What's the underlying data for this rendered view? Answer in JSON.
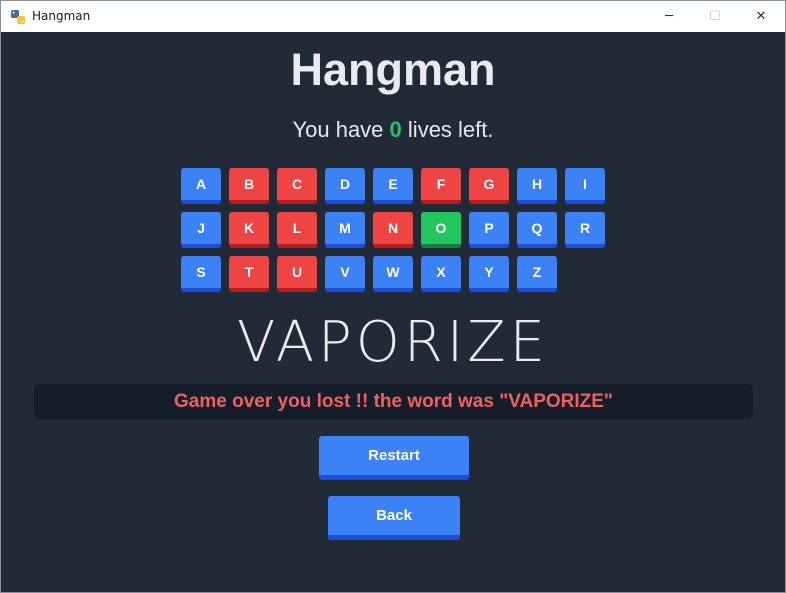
{
  "window": {
    "title": "Hangman",
    "minimize_glyph": "─",
    "maximize_glyph": "☐",
    "close_glyph": "✕"
  },
  "game": {
    "title": "Hangman",
    "lives_prefix": "You have",
    "lives_count": "0",
    "lives_suffix": "lives left.",
    "word": "VAPORIZE",
    "message": "Game over you lost !! the word was \"VAPORIZE\""
  },
  "keyboard": {
    "rows": [
      [
        {
          "letter": "A",
          "state": "unused"
        },
        {
          "letter": "B",
          "state": "wrong"
        },
        {
          "letter": "C",
          "state": "wrong"
        },
        {
          "letter": "D",
          "state": "unused"
        },
        {
          "letter": "E",
          "state": "unused"
        },
        {
          "letter": "F",
          "state": "wrong"
        },
        {
          "letter": "G",
          "state": "wrong"
        },
        {
          "letter": "H",
          "state": "unused"
        },
        {
          "letter": "I",
          "state": "unused"
        }
      ],
      [
        {
          "letter": "J",
          "state": "unused"
        },
        {
          "letter": "K",
          "state": "wrong"
        },
        {
          "letter": "L",
          "state": "wrong"
        },
        {
          "letter": "M",
          "state": "unused"
        },
        {
          "letter": "N",
          "state": "wrong"
        },
        {
          "letter": "O",
          "state": "right"
        },
        {
          "letter": "P",
          "state": "unused"
        },
        {
          "letter": "Q",
          "state": "unused"
        },
        {
          "letter": "R",
          "state": "unused"
        }
      ],
      [
        {
          "letter": "S",
          "state": "unused"
        },
        {
          "letter": "T",
          "state": "wrong"
        },
        {
          "letter": "U",
          "state": "wrong"
        },
        {
          "letter": "V",
          "state": "unused"
        },
        {
          "letter": "W",
          "state": "unused"
        },
        {
          "letter": "X",
          "state": "unused"
        },
        {
          "letter": "Y",
          "state": "unused"
        },
        {
          "letter": "Z",
          "state": "unused"
        }
      ]
    ]
  },
  "buttons": {
    "restart_label": "Restart",
    "back_label": "Back"
  },
  "colors": {
    "background": "#222a37",
    "key_unused": "#3b82f6",
    "key_wrong": "#ef4444",
    "key_right": "#22c55e",
    "message": "#f0605f"
  }
}
